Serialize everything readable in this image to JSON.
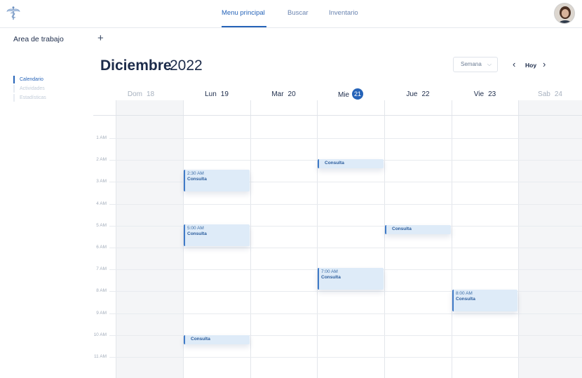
{
  "nav": {
    "items": [
      {
        "label": "Menu principal",
        "active": true
      },
      {
        "label": "Buscar",
        "active": false
      },
      {
        "label": "Inventario",
        "active": false
      }
    ]
  },
  "sidebar": {
    "title": "Area de trabajo",
    "items": [
      {
        "label": "Calendario",
        "active": true
      },
      {
        "label": "Actividades",
        "active": false
      },
      {
        "label": "Estadísticas",
        "active": false
      }
    ]
  },
  "toolbar": {
    "add_icon": "+",
    "month": "Diciembre",
    "year": "2022",
    "view": "Semana",
    "today_label": "Hoy",
    "prev_icon": "‹",
    "next_icon": "›"
  },
  "week": {
    "days": [
      {
        "name": "Dom",
        "num": "18",
        "muted": true,
        "today": false
      },
      {
        "name": "Lun",
        "num": "19",
        "muted": false,
        "today": false
      },
      {
        "name": "Mar",
        "num": "20",
        "muted": false,
        "today": false
      },
      {
        "name": "Mie",
        "num": "21",
        "muted": false,
        "today": true
      },
      {
        "name": "Jue",
        "num": "22",
        "muted": false,
        "today": false
      },
      {
        "name": "Vie",
        "num": "23",
        "muted": false,
        "today": false
      },
      {
        "name": "Sab",
        "num": "24",
        "muted": true,
        "today": false
      }
    ],
    "hours": [
      "1 AM",
      "2 AM",
      "3 AM",
      "4 AM",
      "5 AM",
      "6 AM",
      "7 AM",
      "8 AM",
      "9 AM",
      "10 AM",
      "11 AM"
    ]
  },
  "events": [
    {
      "day": 1,
      "time": "2:30 AM",
      "title": "Consulta"
    },
    {
      "day": 1,
      "time": "5:00 AM",
      "title": "Consulta"
    },
    {
      "day": 1,
      "time": "",
      "title": "Consulta"
    },
    {
      "day": 3,
      "time": "",
      "title": "Consulta"
    },
    {
      "day": 3,
      "time": "7:00 AM",
      "title": "Consulta"
    },
    {
      "day": 4,
      "time": "",
      "title": "Consulta"
    },
    {
      "day": 5,
      "time": "8:00 AM",
      "title": "Consulta"
    }
  ],
  "colors": {
    "accent": "#2563b8",
    "event_bg": "#deebf8",
    "event_border": "#3f7ac7",
    "weekend_bg": "#f4f5f7"
  },
  "icons": {
    "logo": "caduceus-icon",
    "avatar": "user-avatar",
    "prev": "chevron-left-icon",
    "next": "chevron-right-icon",
    "dropdown": "chevron-down-icon",
    "add": "plus-icon"
  }
}
